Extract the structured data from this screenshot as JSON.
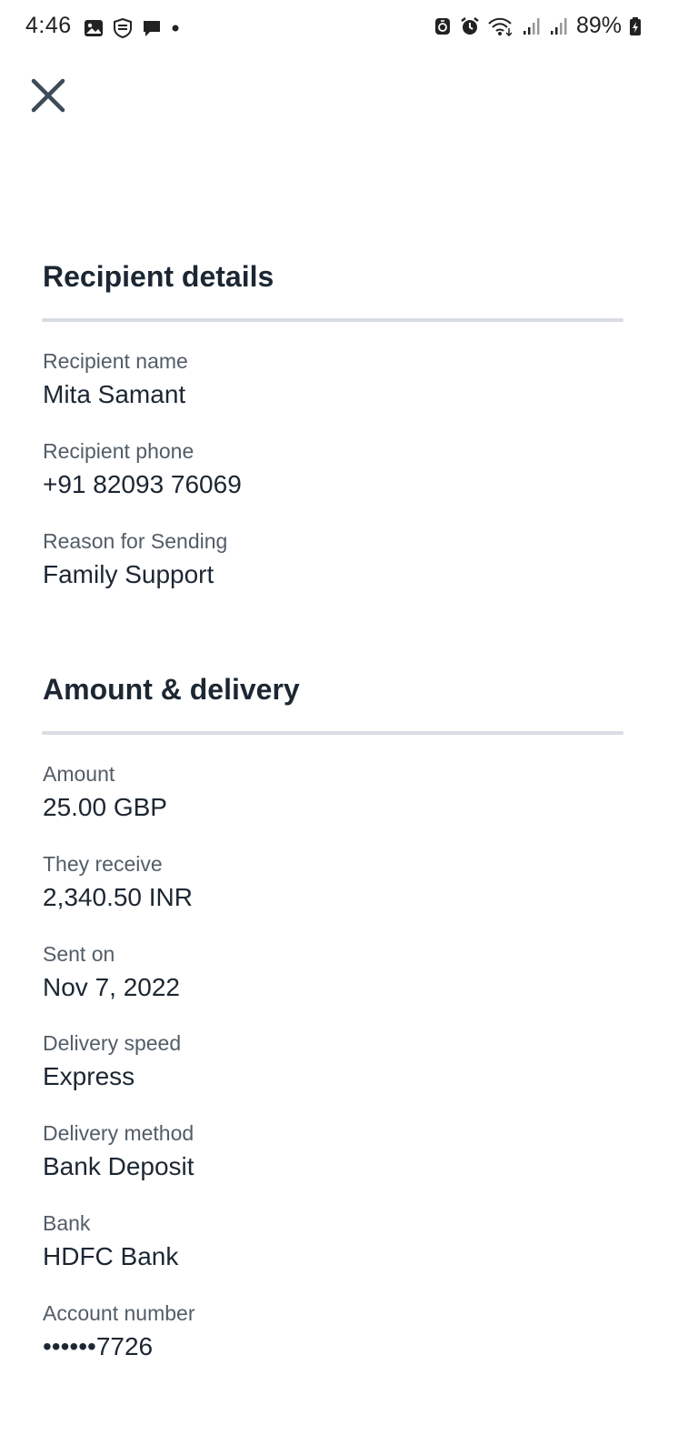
{
  "status_bar": {
    "time": "4:46",
    "battery": "89%",
    "left_icons": [
      "gallery-icon",
      "shield-icon",
      "message-icon",
      "dot-icon"
    ],
    "right_icons": [
      "lock-alarm-icon",
      "alarm-icon",
      "wifi-icon",
      "signal-icon",
      "signal-icon",
      "battery-icon"
    ]
  },
  "recipient": {
    "title": "Recipient details",
    "fields": [
      {
        "label": "Recipient name",
        "value": "Mita Samant"
      },
      {
        "label": "Recipient phone",
        "value": "+91 82093 76069"
      },
      {
        "label": "Reason for Sending",
        "value": "Family Support"
      }
    ]
  },
  "delivery": {
    "title": "Amount & delivery",
    "fields": [
      {
        "label": "Amount",
        "value": "25.00 GBP"
      },
      {
        "label": "They receive",
        "value": "2,340.50 INR"
      },
      {
        "label": "Sent on",
        "value": "Nov 7, 2022"
      },
      {
        "label": "Delivery speed",
        "value": "Express"
      },
      {
        "label": "Delivery method",
        "value": "Bank Deposit"
      },
      {
        "label": "Bank",
        "value": "HDFC Bank"
      },
      {
        "label": "Account number",
        "value": "••••••7726"
      }
    ]
  },
  "colors": {
    "text_primary": "#1c2733",
    "text_secondary": "#525d68",
    "divider": "#d8dde3"
  }
}
